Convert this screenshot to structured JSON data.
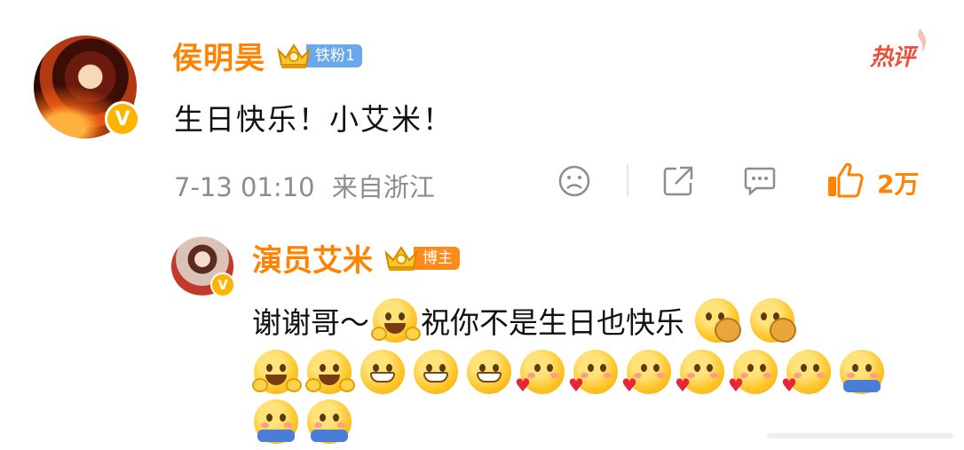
{
  "post": {
    "author": "侯明昊",
    "fan_badge": "铁粉1",
    "hot_tag": "热评",
    "text": "生日快乐！小艾米！",
    "timestamp": "7-13 01:10",
    "location": "来自浙江",
    "likes": "2万"
  },
  "reply": {
    "author": "演员艾米",
    "badge": "博主",
    "text_part1": "谢谢哥～",
    "text_part2": "祝你不是生日也快乐",
    "emojis_line1_trailing": [
      "cookie-laugh",
      "cookie-laugh"
    ],
    "emojis_line2": [
      "cheer",
      "cheer",
      "grin",
      "grin",
      "grin",
      "heart-kiss",
      "heart-kiss",
      "heart-kiss",
      "heart-kiss",
      "heart-kiss",
      "heart-kiss",
      "hug"
    ],
    "emojis_line3": [
      "hug",
      "hug"
    ]
  },
  "colors": {
    "accent": "#ff8200",
    "badge_blue": "#6aa8ee",
    "verified": "#ffb400",
    "hot": "#e8503a"
  },
  "icons": [
    "verified-icon",
    "crown-icon",
    "dislike-face-icon",
    "share-icon",
    "comment-icon",
    "thumbs-up-icon"
  ]
}
